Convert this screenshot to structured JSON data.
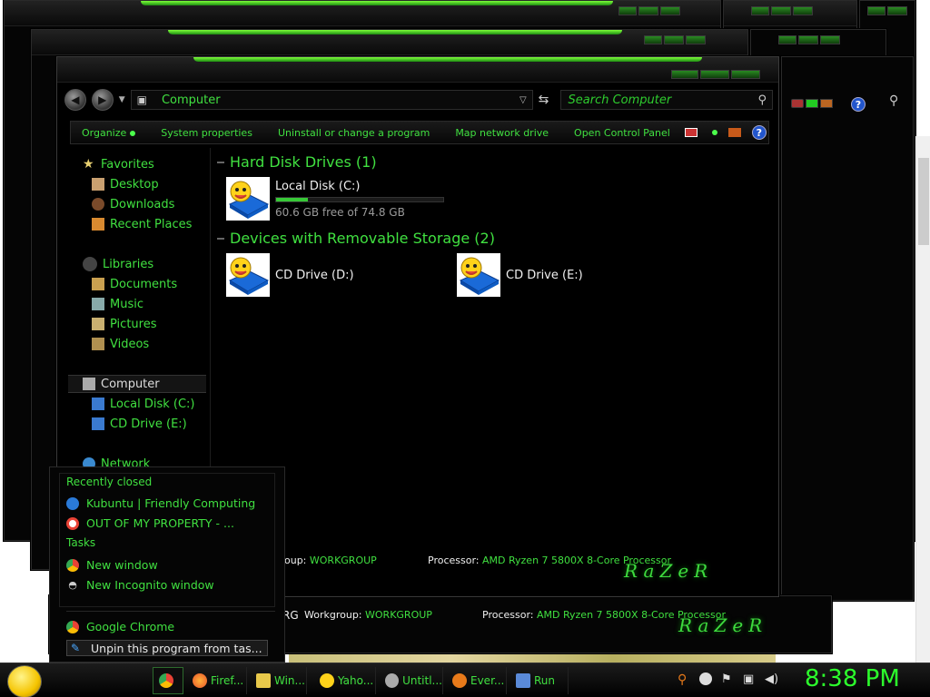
{
  "explorer": {
    "address": "Computer",
    "search_placeholder": "Search Computer",
    "commands": [
      "Organize",
      "System properties",
      "Uninstall or change a program",
      "Map network drive",
      "Open Control Panel"
    ],
    "nav": {
      "favorites": "Favorites",
      "desktop": "Desktop",
      "downloads": "Downloads",
      "recent": "Recent Places",
      "libraries": "Libraries",
      "documents": "Documents",
      "music": "Music",
      "pictures": "Pictures",
      "videos": "Videos",
      "computer": "Computer",
      "local_c": "Local Disk (C:)",
      "cd_e": "CD Drive (E:)",
      "network": "Network"
    },
    "groups": {
      "hdd": "Hard Disk Drives (1)",
      "removable": "Devices with Removable Storage (2)"
    },
    "drives": {
      "c_label": "Local Disk (C:)",
      "c_free": "60.6 GB free of 74.8 GB",
      "c_used_fraction": 0.19,
      "d_label": "CD Drive (D:)",
      "e_label": "CD Drive (E:)"
    },
    "details": {
      "workgroup_key": "oup:",
      "workgroup_key_full": "Workgroup:",
      "workgroup_value": "WORKGROUP",
      "processor_key": "Processor:",
      "processor_value": "AMD Ryzen 7 5800X 8-Core Processor",
      "rg": "RG"
    },
    "brand": "RaZeR"
  },
  "jumplist": {
    "recent_header": "Recently closed",
    "recent": [
      "Kubuntu | Friendly Computing",
      "OUT OF MY PROPERTY - ..."
    ],
    "tasks_header": "Tasks",
    "tasks": [
      "New window",
      "New Incognito window"
    ],
    "app": "Google Chrome",
    "unpin": "Unpin this program from tas..."
  },
  "taskbar": {
    "items": [
      "Firef...",
      "Win...",
      "Yaho...",
      "Untitl...",
      "Ever...",
      "Run"
    ],
    "clock": "8:38 PM"
  }
}
